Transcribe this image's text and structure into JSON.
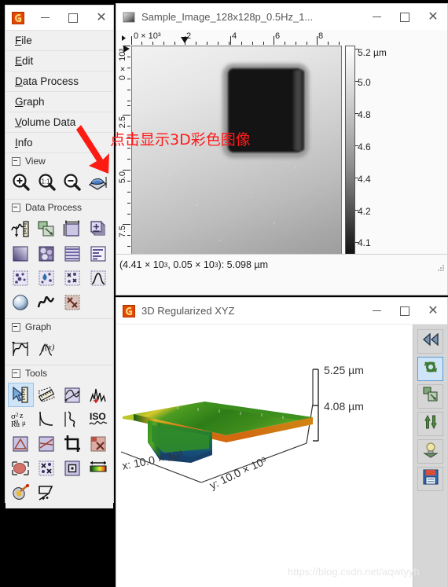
{
  "toolbox": {
    "window_title": "",
    "app_icon": "gwyddion-logo-icon",
    "controls": {
      "minimize": "—",
      "maximize": "□",
      "close": "✕"
    },
    "menu": [
      {
        "label": "File",
        "mnemonic": "F"
      },
      {
        "label": "Edit",
        "mnemonic": "E"
      },
      {
        "label": "Data Process",
        "mnemonic": "D"
      },
      {
        "label": "Graph",
        "mnemonic": "G"
      },
      {
        "label": "Volume Data",
        "mnemonic": "V"
      },
      {
        "label": "Info",
        "mnemonic": "I"
      }
    ],
    "sections": [
      {
        "title": "View",
        "icons": [
          {
            "name": "zoom-in-icon"
          },
          {
            "name": "zoom-1-1-icon"
          },
          {
            "name": "zoom-out-icon"
          },
          {
            "name": "display-3d-icon",
            "selected": false
          }
        ]
      },
      {
        "title": "Data Process",
        "icons": [
          {
            "name": "scan-profile-icon"
          },
          {
            "name": "crop-layers-icon"
          },
          {
            "name": "resize-image-icon"
          },
          {
            "name": "arithmetic-icon"
          },
          {
            "name": "level-plane-icon"
          },
          {
            "name": "grains-icon"
          },
          {
            "name": "line-correct-icon"
          },
          {
            "name": "rows-stats-icon"
          },
          {
            "name": "mark-grains-icon"
          },
          {
            "name": "drop-mark-icon"
          },
          {
            "name": "remove-spots-icon"
          },
          {
            "name": "statistics-curve-icon"
          },
          {
            "name": "sphere-revolve-icon"
          },
          {
            "name": "wave-fft-icon"
          },
          {
            "name": "mask-remove-icon"
          }
        ]
      },
      {
        "title": "Graph",
        "icons": [
          {
            "name": "graph-extract-icon"
          },
          {
            "name": "graph-function-icon"
          }
        ]
      },
      {
        "title": "Tools",
        "icons": [
          {
            "name": "pointer-measure-icon",
            "selected": true
          },
          {
            "name": "distance-measure-icon"
          },
          {
            "name": "profile-extract-icon"
          },
          {
            "name": "spectro-icon"
          },
          {
            "name": "stats-quantities-icon"
          },
          {
            "name": "row-stats-icon"
          },
          {
            "name": "correlation-icon"
          },
          {
            "name": "iso-roughness-icon"
          },
          {
            "name": "level-three-point-icon"
          },
          {
            "name": "path-level-icon"
          },
          {
            "name": "crop-tool-icon"
          },
          {
            "name": "mask-editor-icon"
          },
          {
            "name": "grain-measure-icon"
          },
          {
            "name": "grain-remove-icon"
          },
          {
            "name": "selection-manager-icon"
          },
          {
            "name": "color-range-icon"
          },
          {
            "name": "filter-tool-icon"
          },
          {
            "name": "spot-remove-icon"
          }
        ]
      }
    ]
  },
  "image_window": {
    "title": "Sample_Image_128x128p_0.5Hz_1...",
    "icon": "image-thumbnail-icon",
    "controls": {
      "minimize": "—",
      "maximize": "□",
      "close": "✕"
    },
    "h_ruler": {
      "unit_label": "0 × 10³",
      "ticks": [
        "2",
        "4",
        "6",
        "8"
      ]
    },
    "v_ruler": {
      "unit_label": "0 × 10³",
      "ticks": [
        "2.5",
        "5.0",
        "7.5"
      ]
    },
    "colorbar": {
      "top_unit": "5.2 µm",
      "labels": [
        "5.0",
        "4.8",
        "4.6",
        "4.4",
        "4.2",
        "4.1"
      ]
    },
    "status": {
      "coords_prefix": "(4.41 × 10",
      "coords_mid": ", 0.05 × 10",
      "coords_suffix": "): 5.098 µm",
      "exponent": "3",
      "full": "(4.41 × 10³, 0.05 × 10³): 5.098 µm"
    }
  },
  "window_3d": {
    "title": "3D Regularized XYZ",
    "icon": "gwyddion-logo-icon",
    "controls": {
      "minimize": "—",
      "maximize": "□",
      "close": "✕"
    },
    "axis_labels": {
      "x": "x: 10.0 × 10³",
      "y": "y: 10.0 × 10³",
      "z_top": "5.25 µm",
      "z_bottom": "4.08 µm"
    },
    "toolbar": [
      {
        "name": "rewind-icon",
        "selected": false
      },
      {
        "name": "rotate-icon",
        "selected": true
      },
      {
        "name": "scale-icon",
        "selected": false
      },
      {
        "name": "z-scale-icon",
        "selected": false
      },
      {
        "name": "light-icon",
        "selected": false
      },
      {
        "name": "save-icon",
        "selected": false
      }
    ]
  },
  "annotation": {
    "text": "点击显示3D彩色图像",
    "arrow": "red-down-arrow",
    "color": "#ff1a1a"
  },
  "watermark": {
    "text": "https://blog.csdn.net/aqwtyyh"
  },
  "colors": {
    "accent_selected": "#cfe4f7",
    "window_bg": "#f0f0f0",
    "annotation_red": "#ff1a1a",
    "toolbar_3d_bg": "#d6d6d6"
  }
}
